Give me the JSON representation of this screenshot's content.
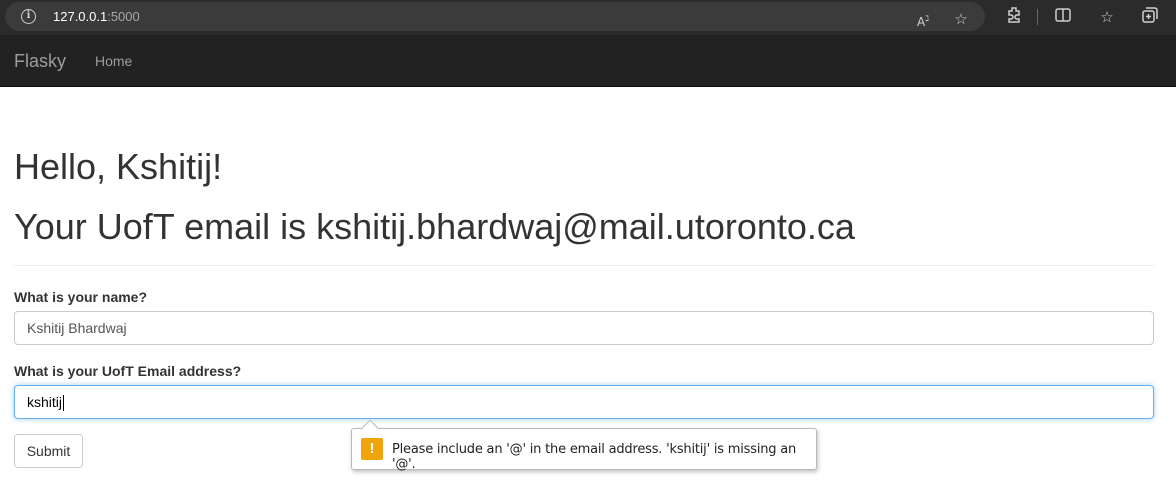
{
  "browser": {
    "url_host": "127.0.0.1",
    "url_port": ":5000",
    "icons": [
      "info-icon",
      "read-aloud-icon",
      "favorite-star-icon",
      "extensions-icon",
      "split-screen-icon",
      "favorites-icon",
      "collections-icon"
    ]
  },
  "navbar": {
    "brand": "Flasky",
    "home_label": "Home",
    "background": "#222222"
  },
  "main": {
    "greeting": "Hello, Kshitij!",
    "email_line": "Your UofT email is kshitij.bhardwaj@mail.utoronto.ca"
  },
  "form": {
    "name_label": "What is your name?",
    "name_value": "Kshitij Bhardwaj",
    "email_label": "What is your UofT Email address?",
    "email_value": "kshitij",
    "submit_label": "Submit"
  },
  "validation": {
    "icon": "!",
    "message": "Please include an '@' in the email address. 'kshitij' is missing an '@'.",
    "icon_color": "#f0a30a"
  }
}
